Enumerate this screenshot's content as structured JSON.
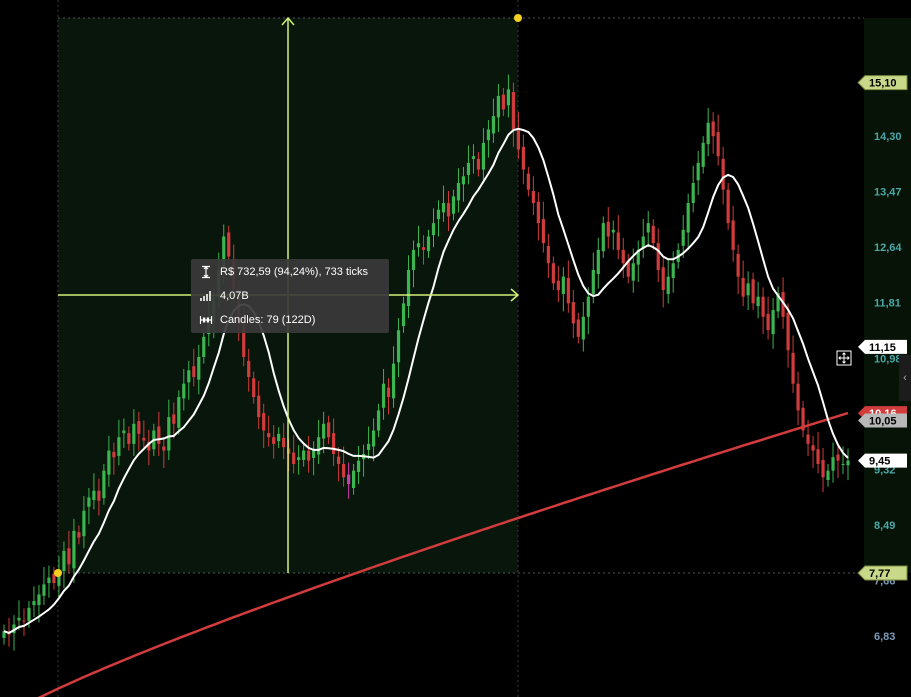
{
  "chart_data": {
    "type": "candlestick",
    "y_range": [
      6.7,
      15.3
    ],
    "price_axis_ticks": [
      "14,30",
      "13,47",
      "12,64",
      "11,81",
      "10,98",
      "9,32",
      "8,49",
      "7,66",
      "6,83"
    ],
    "price_markers": [
      {
        "value": 15.1,
        "label": "15,10",
        "style": "selection",
        "color": "#c9d98a"
      },
      {
        "value": 11.15,
        "label": "11,15",
        "style": "sma_short",
        "color": "#ffffff"
      },
      {
        "value": 10.16,
        "label": "10,16",
        "style": "sma_long",
        "color": "#d23c3c"
      },
      {
        "value": 10.05,
        "label": "10,05",
        "style": "last",
        "color": "#b8b8b8"
      },
      {
        "value": 9.45,
        "label": "9,45",
        "style": "price",
        "color": "#ffffff"
      },
      {
        "value": 7.77,
        "label": "7,77",
        "style": "selection",
        "color": "#c9d98a"
      }
    ],
    "closes": [
      6.9,
      6.85,
      7.0,
      7.1,
      7.05,
      7.25,
      7.35,
      7.45,
      7.6,
      7.7,
      7.62,
      7.8,
      8.1,
      7.9,
      8.4,
      8.3,
      8.7,
      8.9,
      9.0,
      8.85,
      9.3,
      9.6,
      9.5,
      9.8,
      9.9,
      9.7,
      10.0,
      9.85,
      9.75,
      9.6,
      9.9,
      9.7,
      9.6,
      10.1,
      10.0,
      10.4,
      10.6,
      10.8,
      10.7,
      11.0,
      11.3,
      11.6,
      11.9,
      12.3,
      12.8,
      12.5,
      12.0,
      11.5,
      11.0,
      10.7,
      10.4,
      10.1,
      9.9,
      9.8,
      9.7,
      9.85,
      9.65,
      9.55,
      9.4,
      9.5,
      9.6,
      9.45,
      9.6,
      9.8,
      10.0,
      9.8,
      9.55,
      9.4,
      9.2,
      9.1,
      9.3,
      9.45,
      9.55,
      9.7,
      9.9,
      10.2,
      10.6,
      10.4,
      10.9,
      11.4,
      11.8,
      12.3,
      12.6,
      12.7,
      12.6,
      12.8,
      13.0,
      13.2,
      13.3,
      13.1,
      13.4,
      13.6,
      13.7,
      13.9,
      14.0,
      13.8,
      14.2,
      14.4,
      14.6,
      14.9,
      14.7,
      15.0,
      14.4,
      14.1,
      13.8,
      13.5,
      13.3,
      13.0,
      12.7,
      12.4,
      12.1,
      12.0,
      12.2,
      11.8,
      11.5,
      11.3,
      11.6,
      11.9,
      12.3,
      12.6,
      13.0,
      12.8,
      12.9,
      12.6,
      12.4,
      12.2,
      12.4,
      12.6,
      12.8,
      13.0,
      12.7,
      12.3,
      12.0,
      12.2,
      12.4,
      12.6,
      12.9,
      13.3,
      13.6,
      13.9,
      14.2,
      14.5,
      14.3,
      14.0,
      13.5,
      13.0,
      12.6,
      12.2,
      11.9,
      12.1,
      11.8,
      11.9,
      11.6,
      11.4,
      11.7,
      11.95,
      11.6,
      11.1,
      10.6,
      10.2,
      9.9,
      9.7,
      9.6,
      9.4,
      9.2,
      9.3,
      9.5,
      9.45,
      9.4,
      9.45
    ]
  },
  "tooltip": {
    "range_text": "R$ 732,59 (94,24%), 733 ticks",
    "volume_text": "4,07B",
    "candles_text": "Candles: 79 (122D)"
  },
  "colors": {
    "up": "#3cb450",
    "down": "#d03c3c",
    "highlight": "#c83ca8",
    "sma_short": "#ffffff",
    "sma_long": "#d23c3c",
    "selection_fill": "#08160c",
    "crosshair": "#d6f07a",
    "axis_panel": "#061306",
    "axis_text": "#4aa8a8",
    "axis_text_low": "#7a9ab8",
    "grid": "#3a3a3a"
  },
  "icons": {
    "range": "vertical-range-icon",
    "volume": "volume-bars-icon",
    "candles": "candle-span-icon",
    "collapse": "chevron-left-icon",
    "cursor": "move-cursor-icon"
  }
}
